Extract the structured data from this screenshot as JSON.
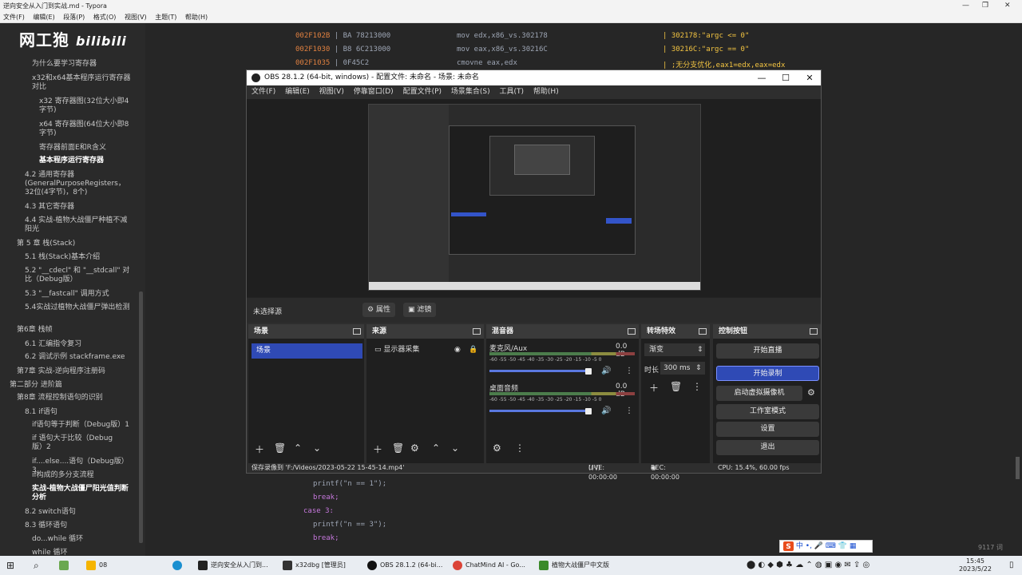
{
  "typora": {
    "title": "逆向安全从入门到实战.md - Typora",
    "menu": [
      "文件(F)",
      "编辑(E)",
      "段落(P)",
      "格式(O)",
      "视图(V)",
      "主题(T)",
      "帮助(H)"
    ],
    "logo": "网工狍",
    "logo_sub": "bilibili",
    "outline": [
      "为什么要学习寄存器",
      "x32和x64基本程序运行寄存器对比",
      "x32 寄存器图(32位大小即4字节)",
      "x64 寄存器图(64位大小即8字节)",
      "寄存器前面E和R含义",
      "基本程序运行寄存器",
      "4.2 通用寄存器(GeneralPurposeRegisters，32位(4字节)，8个)",
      "4.3 其它寄存器",
      "4.4 实战-植物大战僵尸种植不减阳光",
      "第 5 章 栈(Stack)",
      "5.1 栈(Stack)基本介绍",
      "5.2 \"__cdecl\" 和 \"__stdcall\" 对比（Debug版）",
      "5.3 \"__fastcall\" 调用方式",
      "5.4实战过植物大战僵尸弹出检测",
      "第6章 栈帧",
      "6.1 汇编指令复习",
      "6.2 调试示例 stackframe.exe",
      "第7章 实战-逆向程序注册码",
      "第二部分 进阶篇",
      "第8章 流程控制语句的识别",
      "8.1 if语句",
      "if语句等于判断（Debug版）1",
      "if 语句大于比较（Debug版）2",
      "if....else....语句（Debug版）3",
      "if构成的多分支流程",
      "实战-植物大战僵尸阳光值判断分析",
      "8.2 switch语句",
      "8.3 循环语句",
      "do...while 循环",
      "while 循环"
    ],
    "asm": [
      {
        "addr": "002F102B",
        "bytes": "BA 78213000",
        "instr": "mov edx,x86_vs.302178",
        "cmt": "302178:\"argc <= 0\""
      },
      {
        "addr": "002F1030",
        "bytes": "B8 6C213000",
        "instr": "mov eax,x86_vs.30216C",
        "cmt": "30216C:\"argc == 0\""
      },
      {
        "addr": "002F1035",
        "bytes": "0F45C2",
        "instr": "cmovne eax,edx",
        "cmt": ";无分支优化,eax1=edx,eax=edx"
      }
    ],
    "code": [
      "printf(\"n == 1\");",
      "break;",
      "case 3:",
      "printf(\"n == 3\");",
      "break;"
    ],
    "word_count": "9117 词"
  },
  "obs": {
    "title": "OBS 28.1.2 (64-bit, windows) - 配置文件: 未命名 - 场景: 未命名",
    "menu": [
      "文件(F)",
      "编辑(E)",
      "视图(V)",
      "停靠窗口(D)",
      "配置文件(P)",
      "场景集合(S)",
      "工具(T)",
      "帮助(H)"
    ],
    "no_source": "未选择源",
    "properties": "属性",
    "filters": "滤镜",
    "docks": {
      "scenes": {
        "title": "场景",
        "items": [
          "场景"
        ]
      },
      "sources": {
        "title": "来源",
        "items": [
          "显示器采集"
        ]
      },
      "mixer": {
        "title": "混音器",
        "channels": [
          {
            "name": "麦克风/Aux",
            "db": "0.0 dB",
            "level": 0.93
          },
          {
            "name": "桌面音频",
            "db": "0.0 dB",
            "level": 0.93
          }
        ],
        "ticks": "-60 -55 -50 -45 -40 -35 -30 -25 -20 -15 -10 -5 0"
      },
      "transitions": {
        "title": "转场特效",
        "type": "渐变",
        "duration_label": "时长",
        "duration": "300 ms"
      },
      "controls": {
        "title": "控制按钮",
        "buttons": [
          "开始直播",
          "开始录制",
          "启动虚拟摄像机",
          "工作室模式",
          "设置",
          "退出"
        ],
        "accent": "#2f4ab5"
      }
    },
    "status": {
      "saved": "保存录像到 'F:/Videos/2023-05-22 15-45-14.mp4'",
      "live": "LIVE: 00:00:00",
      "rec": "REC: 00:00:00",
      "cpu": "CPU: 15.4%, 60.00 fps"
    }
  },
  "taskbar": {
    "items": [
      {
        "label": "08",
        "color": "#f5b400"
      },
      {
        "label": "逆向安全从入门到...",
        "color": "#222"
      },
      {
        "label": "x32dbg [管理员]",
        "color": "#333"
      },
      {
        "label": "OBS 28.1.2 (64-bi...",
        "color": "#111"
      },
      {
        "label": "ChatMind AI - Go...",
        "color": "#db4437"
      },
      {
        "label": "植物大战僵尸中文版",
        "color": "#3a8a2a"
      }
    ],
    "time": "15:45",
    "date": "2023/5/22"
  },
  "ime": {
    "label": "中"
  }
}
